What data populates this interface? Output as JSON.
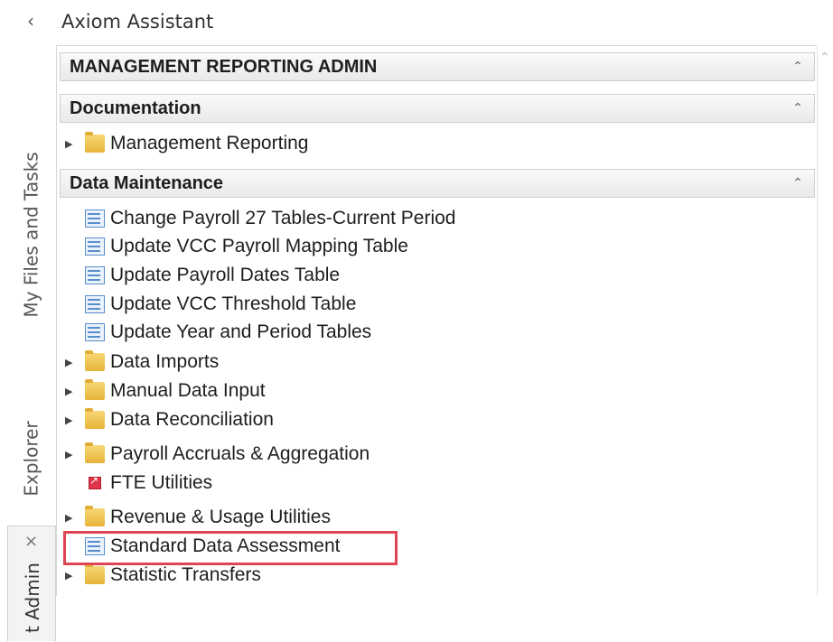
{
  "header": {
    "collapse_glyph": "‹",
    "title": "Axiom Assistant"
  },
  "tabs": [
    {
      "label": "My Files and Tasks"
    },
    {
      "label": "Explorer"
    },
    {
      "label": "t Admin",
      "close_glyph": "×"
    }
  ],
  "sections": [
    {
      "title": "MANAGEMENT REPORTING ADMIN",
      "chevron": "⌃"
    },
    {
      "title": "Documentation",
      "chevron": "⌃",
      "items": [
        {
          "label": "Management Reporting",
          "icon": "folder-icon",
          "expandable": true
        }
      ]
    },
    {
      "title": "Data Maintenance",
      "chevron": "⌃",
      "items": [
        {
          "label": "Change Payroll 27 Tables-Current Period",
          "icon": "report-icon",
          "expandable": false
        },
        {
          "label": "Update VCC Payroll Mapping Table",
          "icon": "report-icon",
          "expandable": false
        },
        {
          "label": "Update Payroll Dates Table",
          "icon": "report-icon",
          "expandable": false
        },
        {
          "label": "Update VCC Threshold Table",
          "icon": "report-icon",
          "expandable": false
        },
        {
          "label": "Update Year and Period Tables",
          "icon": "report-icon",
          "expandable": false
        },
        {
          "label": "Data Imports",
          "icon": "folder-icon",
          "expandable": true
        },
        {
          "label": "Manual Data Input",
          "icon": "folder-icon",
          "expandable": true
        },
        {
          "label": "Data Reconciliation",
          "icon": "folder-icon",
          "expandable": true
        },
        {
          "label": "Payroll Accruals &  Aggregation",
          "icon": "folder-icon",
          "expandable": true
        },
        {
          "label": "FTE Utilities",
          "icon": "shortcut-icon",
          "expandable": false
        },
        {
          "label": "Revenue & Usage Utilities",
          "icon": "folder-icon",
          "expandable": true
        },
        {
          "label": "Standard Data Assessment",
          "icon": "report-icon",
          "expandable": false,
          "highlighted": true
        },
        {
          "label": "Statistic Transfers",
          "icon": "folder-icon",
          "expandable": true
        }
      ]
    }
  ],
  "colors": {
    "highlight": "#e04553",
    "folder": "#e7b43a",
    "report": "#5a8ecb"
  },
  "expand_arrow_glyph": "▶"
}
